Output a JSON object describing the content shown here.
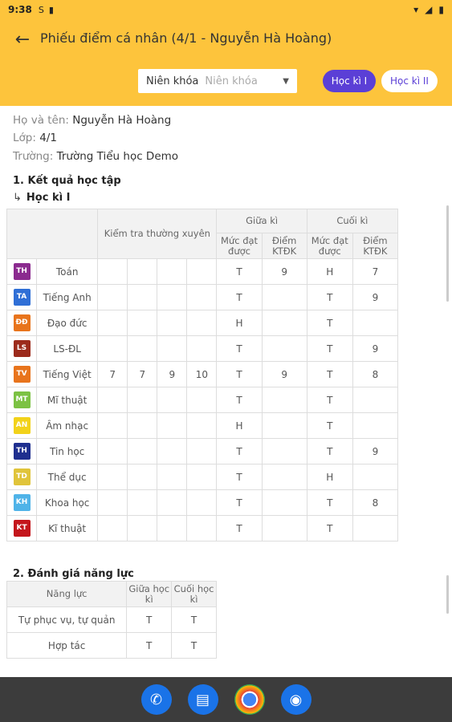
{
  "status": {
    "time": "9:38",
    "icons": [
      "s-icon",
      "sd-card-icon"
    ],
    "right_icons": [
      "wifi-icon",
      "signal-icon",
      "battery-icon"
    ]
  },
  "appbar": {
    "title": "Phiếu điểm cá nhân (4/1 - Nguyễn Hà Hoàng)",
    "filter_label": "Niên khóa",
    "filter_placeholder": "Niên khóa",
    "semester1": "Học kì I",
    "semester2": "Học kì II"
  },
  "student": {
    "name_label": "Họ và tên:",
    "name": "Nguyễn Hà Hoàng",
    "class_label": "Lớp:",
    "class": "4/1",
    "school_label": "Trường:",
    "school": "Trường Tiểu học Demo"
  },
  "section1": {
    "title": "1. Kết quả học tập",
    "semester": "Học kì I"
  },
  "grades_header": {
    "regular": "Kiểm tra thường xuyên",
    "midterm": "Giữa kì",
    "final": "Cuối kì",
    "level": "Mức đạt được",
    "score": "Điểm KTĐK"
  },
  "subjects": [
    {
      "code": "TH",
      "color": "#8b2a8f",
      "name": "Toán",
      "r": [
        "",
        "",
        "",
        ""
      ],
      "mid_level": "T",
      "mid_score": "9",
      "fin_level": "H",
      "fin_score": "7"
    },
    {
      "code": "TA",
      "color": "#2f6fd6",
      "name": "Tiếng Anh",
      "r": [
        "",
        "",
        "",
        ""
      ],
      "mid_level": "T",
      "mid_score": "",
      "fin_level": "T",
      "fin_score": "9"
    },
    {
      "code": "ĐĐ",
      "color": "#e8741c",
      "name": "Đạo đức",
      "r": [
        "",
        "",
        "",
        ""
      ],
      "mid_level": "H",
      "mid_score": "",
      "fin_level": "T",
      "fin_score": ""
    },
    {
      "code": "LS",
      "color": "#9c2b1c",
      "name": "LS-ĐL",
      "r": [
        "",
        "",
        "",
        ""
      ],
      "mid_level": "T",
      "mid_score": "",
      "fin_level": "T",
      "fin_score": "9"
    },
    {
      "code": "TV",
      "color": "#e8741c",
      "name": "Tiếng Việt",
      "r": [
        "7",
        "7",
        "9",
        "10"
      ],
      "mid_level": "T",
      "mid_score": "9",
      "fin_level": "T",
      "fin_score": "8"
    },
    {
      "code": "MT",
      "color": "#7cc243",
      "name": "Mĩ thuật",
      "r": [
        "",
        "",
        "",
        ""
      ],
      "mid_level": "T",
      "mid_score": "",
      "fin_level": "T",
      "fin_score": ""
    },
    {
      "code": "AN",
      "color": "#f2d21a",
      "name": "Âm nhạc",
      "r": [
        "",
        "",
        "",
        ""
      ],
      "mid_level": "H",
      "mid_score": "",
      "fin_level": "T",
      "fin_score": ""
    },
    {
      "code": "TH",
      "color": "#1f2f8f",
      "name": "Tin học",
      "r": [
        "",
        "",
        "",
        ""
      ],
      "mid_level": "T",
      "mid_score": "",
      "fin_level": "T",
      "fin_score": "9"
    },
    {
      "code": "TD",
      "color": "#e0c43a",
      "name": "Thể dục",
      "r": [
        "",
        "",
        "",
        ""
      ],
      "mid_level": "T",
      "mid_score": "",
      "fin_level": "H",
      "fin_score": ""
    },
    {
      "code": "KH",
      "color": "#4fb3e8",
      "name": "Khoa học",
      "r": [
        "",
        "",
        "",
        ""
      ],
      "mid_level": "T",
      "mid_score": "",
      "fin_level": "T",
      "fin_score": "8"
    },
    {
      "code": "KT",
      "color": "#c4161c",
      "name": "Kĩ thuật",
      "r": [
        "",
        "",
        "",
        ""
      ],
      "mid_level": "T",
      "mid_score": "",
      "fin_level": "T",
      "fin_score": ""
    }
  ],
  "section2": {
    "title": "2. Đánh giá năng lực",
    "col_ability": "Năng lực",
    "col_mid": "Giữa học kì",
    "col_final": "Cuối học kì",
    "rows": [
      {
        "name": "Tự phục vụ, tự quản",
        "mid": "T",
        "final": "T"
      },
      {
        "name": "Hợp tác",
        "mid": "T",
        "final": "T"
      }
    ]
  },
  "dock": [
    {
      "name": "phone-app-icon",
      "color": "#1a73e8"
    },
    {
      "name": "messages-app-icon",
      "color": "#1a73e8"
    },
    {
      "name": "chrome-app-icon",
      "color": "#ffffff"
    },
    {
      "name": "camera-app-icon",
      "color": "#1a73e8"
    }
  ]
}
